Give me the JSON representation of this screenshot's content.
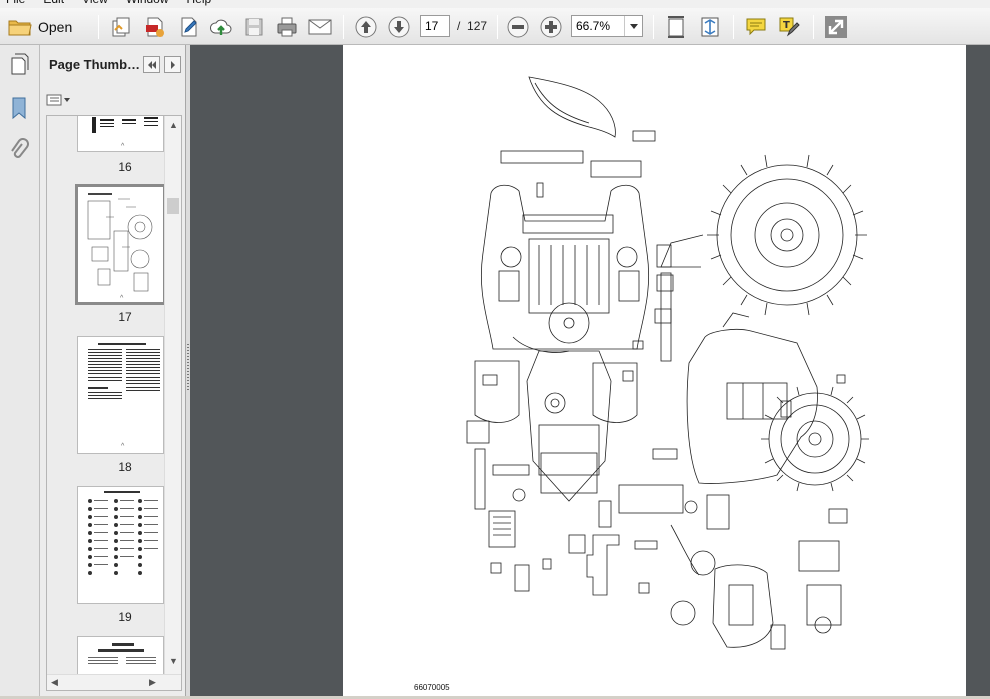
{
  "menubar": {
    "items": [
      "File",
      "Edit",
      "View",
      "Window",
      "Help"
    ]
  },
  "toolbar": {
    "open_label": "Open",
    "current_page": "17",
    "page_separator": "/",
    "page_total": "127",
    "zoom": "66.7%"
  },
  "panel": {
    "title": "Page Thumbna..."
  },
  "thumbnails": [
    {
      "page": "16",
      "selected": false
    },
    {
      "page": "17",
      "selected": true
    },
    {
      "page": "18",
      "selected": false
    },
    {
      "page": "19",
      "selected": false
    }
  ],
  "document": {
    "caption": "66070005"
  },
  "colors": {
    "doc_background": "#525659",
    "toolbar": "#eeeeee",
    "icon_blue": "#3a7bbf"
  },
  "icons": [
    "folder-icon",
    "create-pdf-icon",
    "edit-icon",
    "cloud-upload-icon",
    "save-icon",
    "print-icon",
    "email-icon",
    "prev-page-icon",
    "next-page-icon",
    "zoom-out-icon",
    "zoom-in-icon",
    "fit-width-icon",
    "fit-page-icon",
    "comment-icon",
    "highlight-icon",
    "expand-icon"
  ]
}
